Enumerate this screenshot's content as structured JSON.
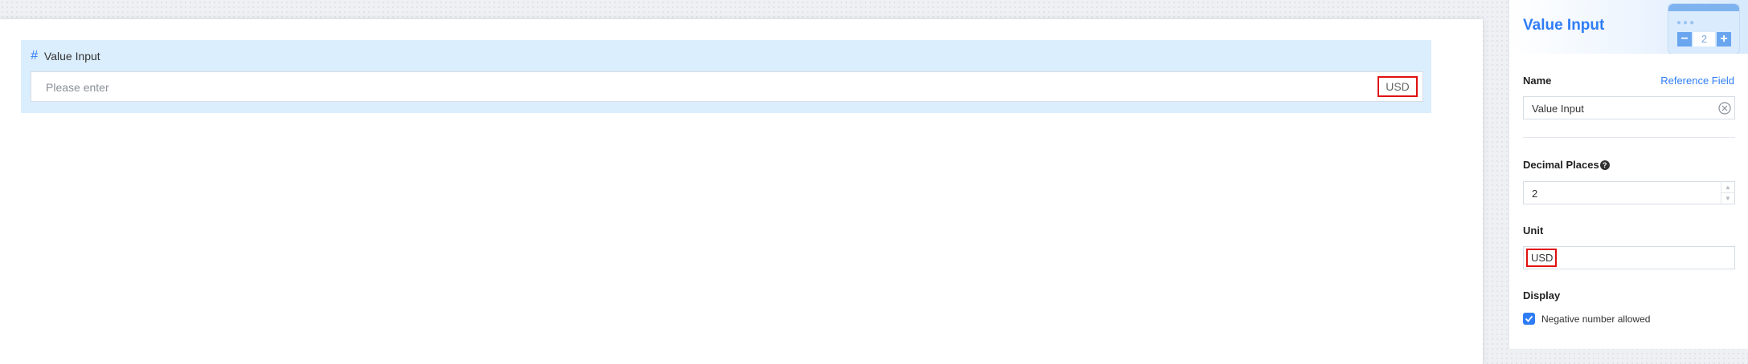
{
  "canvas": {
    "field_title": "Value Input",
    "input_placeholder": "Please enter",
    "unit_suffix": "USD"
  },
  "panel": {
    "title": "Value Input",
    "illustration_value": "2",
    "name_label": "Name",
    "reference_field_link": "Reference Field",
    "name_value": "Value Input",
    "decimal_places_label": "Decimal Places",
    "decimal_places_value": "2",
    "unit_label": "Unit",
    "unit_value": "USD",
    "display_label": "Display",
    "negative_allowed_label": "Negative number allowed",
    "negative_allowed_checked": true
  },
  "colors": {
    "accent": "#2f7df6",
    "highlight": "#e01010",
    "field_background": "#dbeefd"
  }
}
